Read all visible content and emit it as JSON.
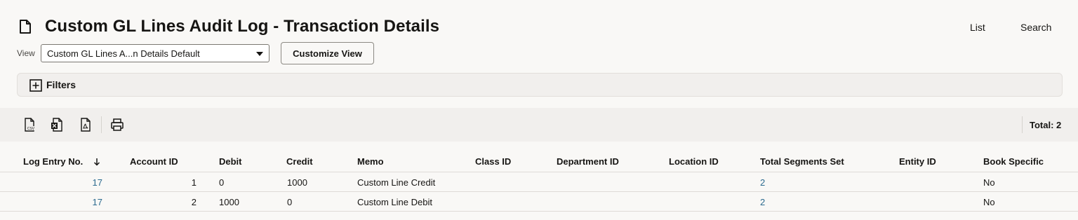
{
  "header": {
    "title": "Custom GL Lines Audit Log - Transaction Details",
    "link_list": "List",
    "link_search": "Search"
  },
  "view": {
    "label": "View",
    "selected": "Custom GL Lines A...n Details Default",
    "customize_label": "Customize View"
  },
  "filters": {
    "label": "Filters"
  },
  "toolbar": {
    "icons": [
      "csv-export-icon",
      "excel-export-icon",
      "pdf-export-icon",
      "print-icon"
    ],
    "total": "Total: 2"
  },
  "table": {
    "columns": [
      "Log Entry No.",
      "Account ID",
      "Debit",
      "Credit",
      "Memo",
      "Class ID",
      "Department ID",
      "Location ID",
      "Total Segments Set",
      "Entity ID",
      "Book Specific"
    ],
    "sort_column": "Log Entry No.",
    "sort_direction": "descending",
    "rows": [
      {
        "log_entry_no": "17",
        "account_id": "1",
        "debit": "0",
        "credit": "1000",
        "memo": "Custom Line Credit",
        "class_id": "",
        "department_id": "",
        "location_id": "",
        "total_segments_set": "2",
        "entity_id": "",
        "book_specific": "No"
      },
      {
        "log_entry_no": "17",
        "account_id": "2",
        "debit": "1000",
        "credit": "0",
        "memo": "Custom Line Debit",
        "class_id": "",
        "department_id": "",
        "location_id": "",
        "total_segments_set": "2",
        "entity_id": "",
        "book_specific": "No"
      }
    ]
  },
  "colors": {
    "link": "#2c6b8f",
    "toolbar_bg": "#f1efed",
    "page_bg": "#f9f8f6"
  }
}
